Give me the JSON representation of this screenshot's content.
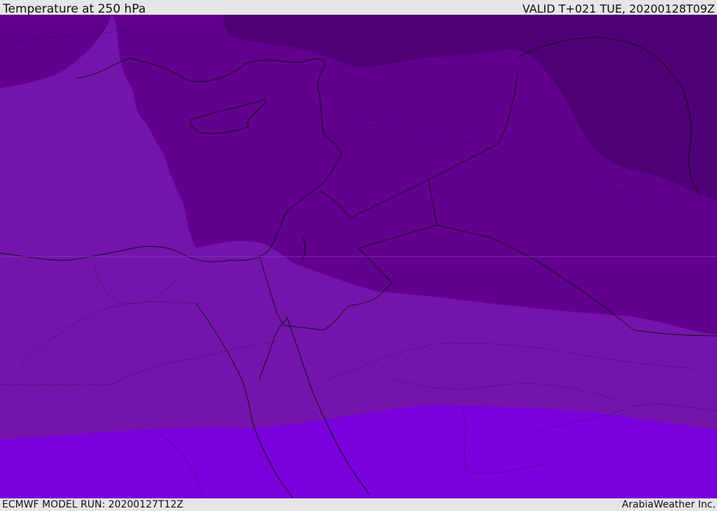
{
  "header": {
    "title": "Temperature at 250 hPa",
    "valid": "VALID T+021 TUE, 20200128T09Z"
  },
  "footer": {
    "model_run": "ECMWF MODEL RUN: 20200127T12Z",
    "brand": "ArabiaWeather Inc."
  },
  "map": {
    "field": "temperature",
    "level": "250 hPa",
    "colors": {
      "coldest": "#4f0077",
      "cold": "#620090",
      "mid": "#7414ad",
      "warm": "#7a00dc",
      "coastline": "#111111"
    }
  }
}
